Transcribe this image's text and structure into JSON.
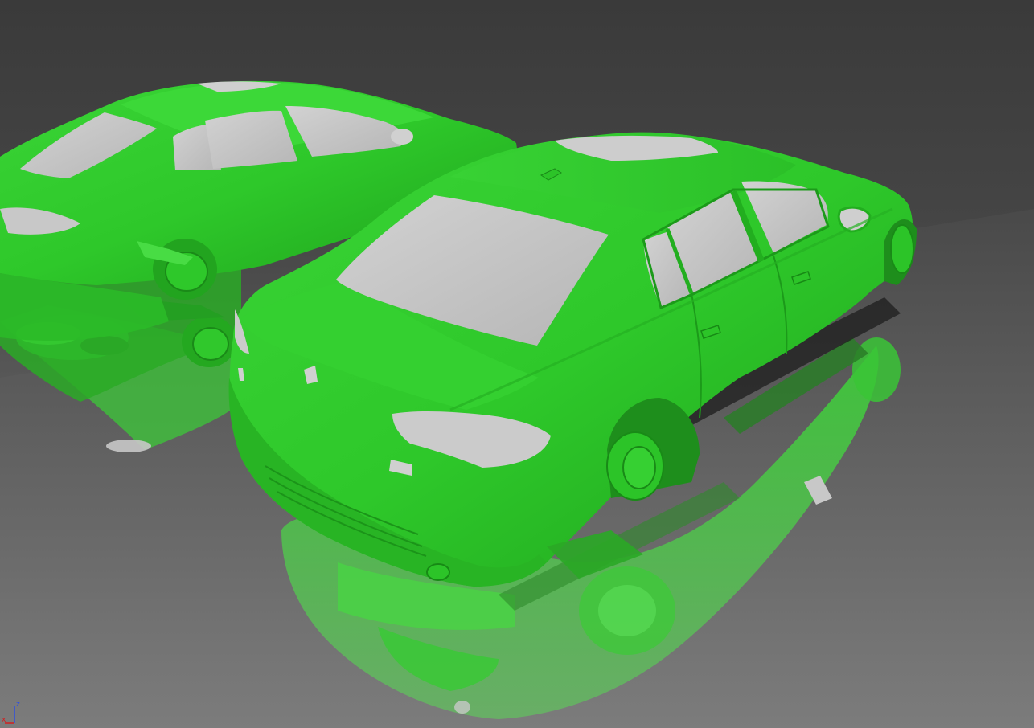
{
  "viewport": {
    "name": "3d-viewport",
    "background_top": "#3a3a3a",
    "background_bottom": "#7a7a7a",
    "model_color": "#2ec82a",
    "glass_color": "#c4c4c4",
    "reflection_color": "#4fd04a"
  },
  "axis_gizmo": {
    "x_label": "x",
    "z_label": "z",
    "x_color": "#d02020",
    "z_color": "#3050e0"
  }
}
